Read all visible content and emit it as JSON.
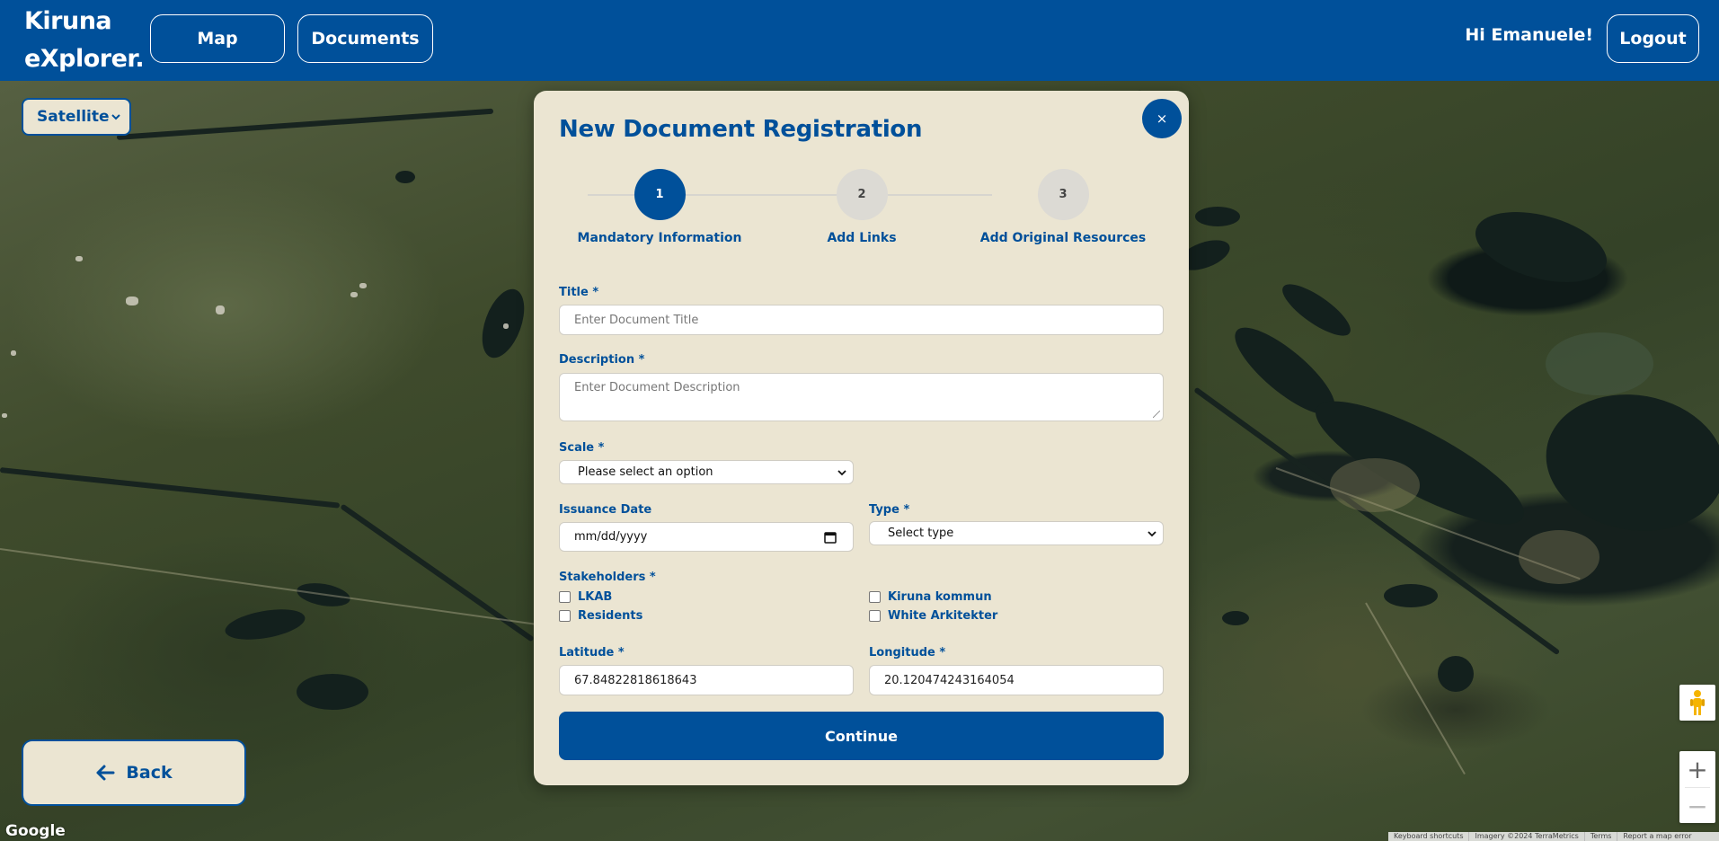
{
  "app": {
    "brand_line1": "Kiruna",
    "brand_line2": "eXplorer."
  },
  "nav": {
    "map_label": "Map",
    "documents_label": "Documents",
    "greeting": "Hi Emanuele!",
    "logout_label": "Logout"
  },
  "map": {
    "type_selected": "Satellite",
    "back_label": "Back",
    "google_logo": "Google",
    "footer": {
      "shortcuts": "Keyboard shortcuts",
      "imagery": "Imagery ©2024 TerraMetrics",
      "terms": "Terms",
      "report": "Report a map error"
    },
    "zoom_in": "+",
    "zoom_out": "−"
  },
  "modal": {
    "title": "New Document Registration",
    "close": "×",
    "steps": [
      {
        "number": "1",
        "label": "Mandatory Information",
        "state": "active"
      },
      {
        "number": "2",
        "label": "Add Links",
        "state": "inactive"
      },
      {
        "number": "3",
        "label": "Add Original Resources",
        "state": "inactive"
      }
    ],
    "title_field": {
      "label": "Title *",
      "placeholder": "Enter Document Title"
    },
    "description_field": {
      "label": "Description *",
      "placeholder": "Enter Document Description"
    },
    "scale_field": {
      "label": "Scale *",
      "selected": "Please select an option"
    },
    "issuance_date_field": {
      "label": "Issuance Date",
      "value": "mm/dd/yyyy"
    },
    "type_field": {
      "label": "Type *",
      "selected": "Select type"
    },
    "stakeholders": {
      "label": "Stakeholders *",
      "options": [
        "LKAB",
        "Residents",
        "Kiruna kommun",
        "White Arkitekter"
      ]
    },
    "latitude_field": {
      "label": "Latitude *",
      "value": "67.84822818618643"
    },
    "longitude_field": {
      "label": "Longitude *",
      "value": "20.120474243164054"
    },
    "continue_label": "Continue"
  },
  "colors": {
    "primary": "#00509a",
    "panel": "#ebe5d2",
    "inactive_step": "#dcdad4"
  }
}
